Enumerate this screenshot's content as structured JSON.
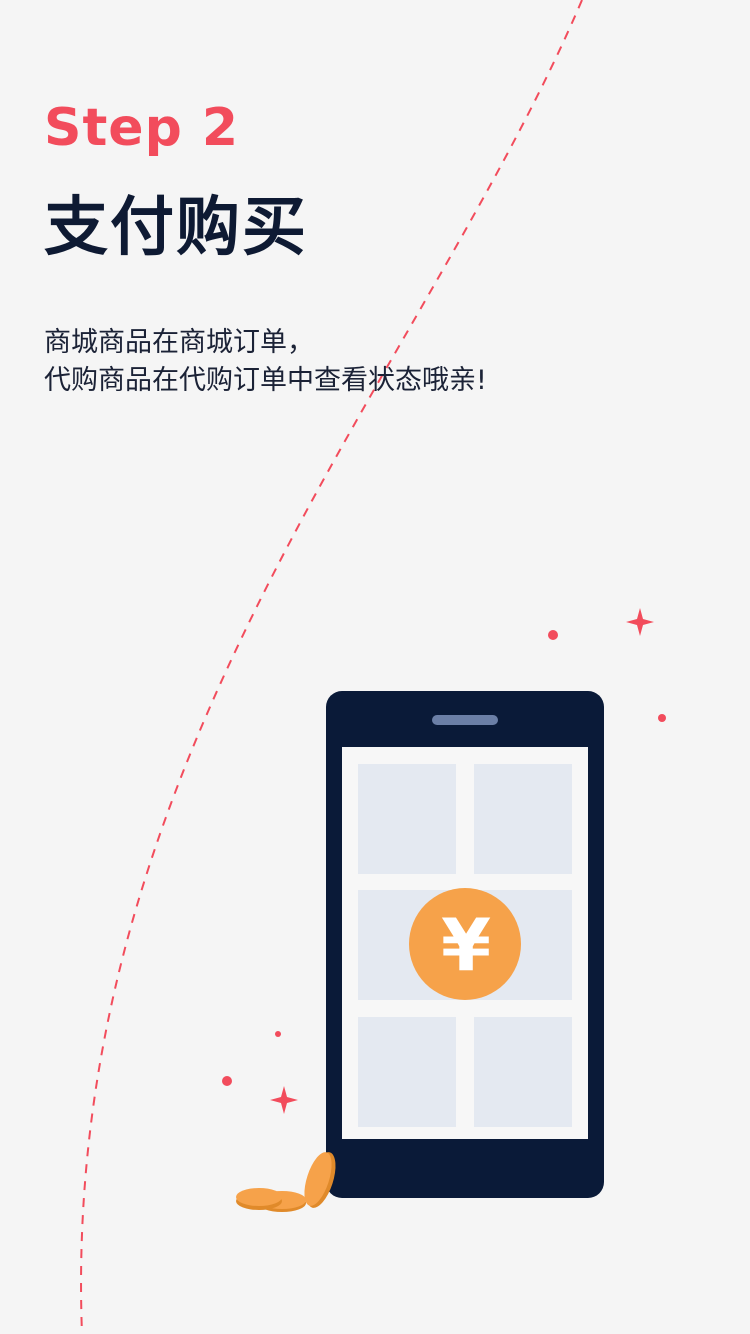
{
  "step": {
    "label": "Step 2",
    "title": "支付购买",
    "description_lines": [
      "商城商品在商城订单，",
      "代购商品在代购订单中查看状态哦亲!"
    ]
  },
  "illustration": {
    "coin_symbol": "¥",
    "icons": [
      "phone-icon",
      "yen-coin-icon",
      "sparkle-icon",
      "dot-icon",
      "stacked-coins-icon",
      "dashed-arc-decoration"
    ]
  },
  "colors": {
    "background": "#f5f5f5",
    "accent": "#f24c5c",
    "title": "#0e1a33",
    "phone_body": "#0a1a38",
    "screen": "#f7f7f7",
    "tile": "#e4e9f1",
    "coin": "#f6a24a",
    "coin_dark": "#e08a2a"
  }
}
